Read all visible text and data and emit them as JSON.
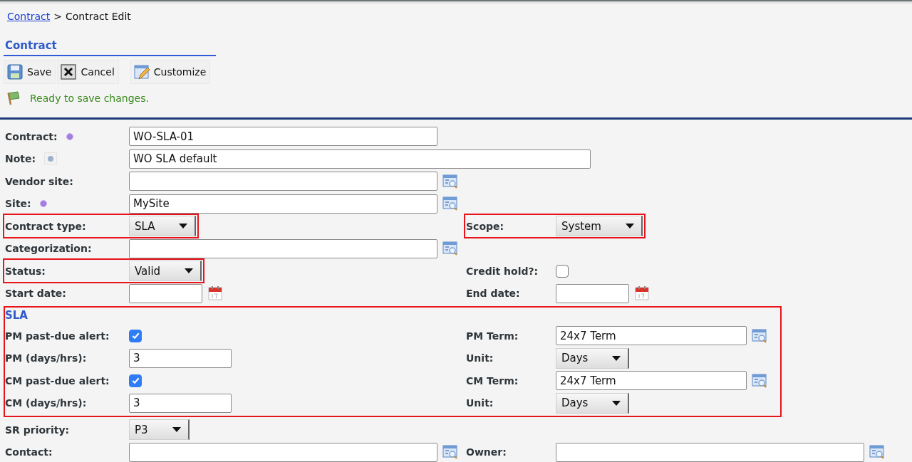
{
  "breadcrumb": {
    "link": "Contract",
    "separator": ">",
    "current": "Contract Edit"
  },
  "section_title": "Contract",
  "toolbar": [
    {
      "label": "Save",
      "kind": "save"
    },
    {
      "label": "Cancel",
      "kind": "cancel"
    },
    {
      "label": "Customize",
      "kind": "customize"
    }
  ],
  "status_message": "Ready to save changes.",
  "rows": [
    {
      "left": {
        "label": "Contract:",
        "required": true,
        "kind": "text",
        "value": "WO-SLA-01",
        "highlighted": false
      }
    },
    {
      "left": {
        "label": "Note:",
        "required": false,
        "help": true,
        "kind": "memo",
        "value": "WO SLA default",
        "highlighted": false
      }
    },
    {
      "left": {
        "label": "Vendor site:",
        "required": false,
        "kind": "lookup",
        "highlighted": false
      }
    },
    {
      "left": {
        "label": "Site:",
        "required": true,
        "kind": "lookup",
        "value": "MySite",
        "highlighted": false
      }
    },
    {
      "left": {
        "label": "Contract type:",
        "required": false,
        "kind": "select",
        "value": "SLA",
        "highlighted": true
      },
      "right": {
        "label": "Scope:",
        "required": false,
        "kind": "select",
        "value": "System",
        "highlighted": true
      }
    },
    {
      "left": {
        "label": "Categorization:",
        "required": false,
        "kind": "lookup",
        "highlighted": false
      }
    },
    {
      "left": {
        "label": "Status:",
        "required": false,
        "kind": "select",
        "value": "Valid",
        "highlighted": true
      },
      "right": {
        "label": "Credit hold?:",
        "required": false,
        "kind": "checkbox",
        "checked": false,
        "highlighted": false
      }
    },
    {
      "left": {
        "label": "Start date:",
        "required": false,
        "kind": "date",
        "highlighted": false
      },
      "right": {
        "label": "End date:",
        "required": false,
        "kind": "date",
        "highlighted": false
      }
    }
  ],
  "sla_section": {
    "title": "SLA",
    "highlighted": true,
    "rows": [
      {
        "left": {
          "label": "PM past-due alert:",
          "kind": "checkbox",
          "checked": true
        },
        "right": {
          "label": "PM Term:",
          "kind": "lookup",
          "value": "24x7 Term"
        }
      },
      {
        "left": {
          "label": "PM (days/hrs):",
          "kind": "number",
          "value": "3"
        },
        "right": {
          "label": "Unit:",
          "kind": "select",
          "value": "Days"
        }
      },
      {
        "left": {
          "label": "CM past-due alert:",
          "kind": "checkbox",
          "checked": true
        },
        "right": {
          "label": "CM Term:",
          "kind": "lookup",
          "value": "24x7 Term"
        }
      },
      {
        "left": {
          "label": "CM (days/hrs):",
          "kind": "number",
          "value": "3"
        },
        "right": {
          "label": "Unit:",
          "kind": "select",
          "value": "Days"
        }
      }
    ]
  },
  "rows_after": [
    {
      "left": {
        "label": "SR priority:",
        "required": false,
        "kind": "select",
        "value": "P3",
        "highlighted": false
      }
    },
    {
      "left": {
        "label": "Contact:",
        "required": false,
        "kind": "lookup",
        "highlighted": false
      },
      "right": {
        "label": "Owner:",
        "required": false,
        "kind": "lookup",
        "highlighted": false
      }
    }
  ]
}
